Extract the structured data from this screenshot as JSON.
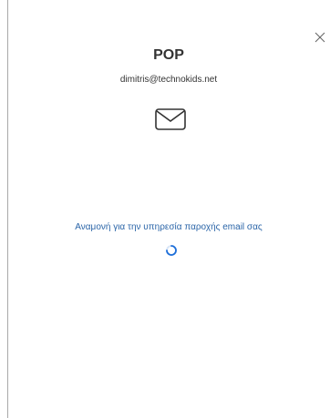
{
  "dialog": {
    "title": "POP",
    "email": "dimitris@technokids.net",
    "status_text": "Αναμονή για την υπηρεσία παροχής email σας",
    "icons": {
      "close": "close-icon",
      "mail": "envelope-icon",
      "spinner": "loading-spinner-icon"
    },
    "colors": {
      "status": "#2b65a8",
      "spinner": "#1e6fd9"
    }
  }
}
